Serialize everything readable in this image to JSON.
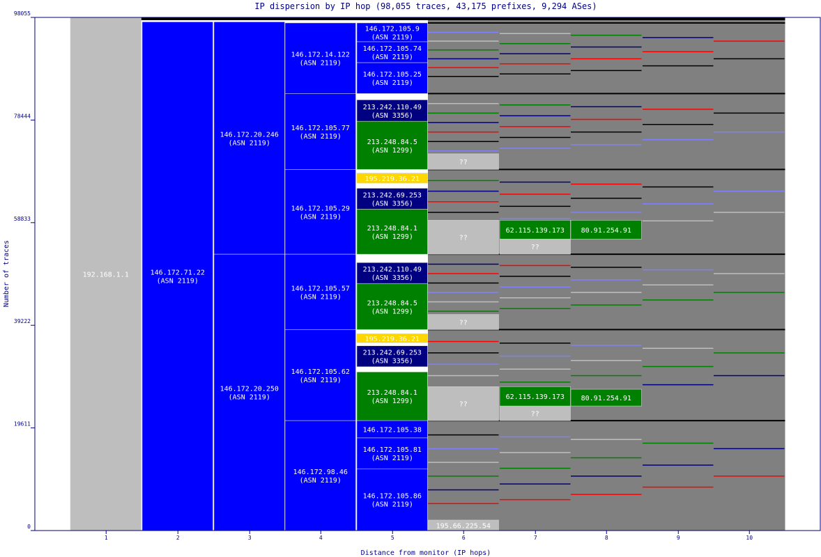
{
  "chart_data": {
    "type": "bar",
    "title": "IP dispersion by IP hop (98,055 traces, 43,175 prefixes, 9,294 ASes)",
    "xlabel": "Distance from monitor (IP hops)",
    "ylabel": "Number of traces",
    "ylim": [
      0,
      98055
    ],
    "yticks": [
      "0",
      "19611",
      "39222",
      "58833",
      "78444",
      "98055"
    ],
    "xticks": [
      "1",
      "2",
      "3",
      "4",
      "5",
      "6",
      "7",
      "8",
      "9",
      "10"
    ],
    "colors": {
      "private": "#bebebe",
      "unknown": "#bebebe",
      "asn2119": "#0000ff",
      "asn3356": "#000080",
      "asn1299": "#008000",
      "yellow": "#ffd700",
      "background": "#808080",
      "label": "#ffffff",
      "axis": "#000080"
    },
    "nodes": [
      {
        "hop": 1,
        "y0": 0,
        "y1": 98055,
        "color": "private",
        "ip": "192.168.1.1",
        "asn": ""
      },
      {
        "hop": 2,
        "y0": 0,
        "y1": 97200,
        "color": "asn2119",
        "ip": "146.172.71.22",
        "asn": "(ASN 2119)"
      },
      {
        "hop": 3,
        "y0": 52800,
        "y1": 97200,
        "color": "asn2119",
        "ip": "146.172.20.246",
        "asn": "(ASN 2119)"
      },
      {
        "hop": 3,
        "y0": 0,
        "y1": 52800,
        "color": "asn2119",
        "ip": "146.172.20.250",
        "asn": "(ASN 2119)"
      },
      {
        "hop": 4,
        "y0": 83500,
        "y1": 97000,
        "color": "asn2119",
        "ip": "146.172.14.122",
        "asn": "(ASN 2119)"
      },
      {
        "hop": 4,
        "y0": 69000,
        "y1": 83500,
        "color": "asn2119",
        "ip": "146.172.105.77",
        "asn": "(ASN 2119)"
      },
      {
        "hop": 4,
        "y0": 52800,
        "y1": 69000,
        "color": "asn2119",
        "ip": "146.172.105.29",
        "asn": "(ASN 2119)"
      },
      {
        "hop": 4,
        "y0": 38400,
        "y1": 52800,
        "color": "asn2119",
        "ip": "146.172.105.57",
        "asn": "(ASN 2119)"
      },
      {
        "hop": 4,
        "y0": 21000,
        "y1": 38400,
        "color": "asn2119",
        "ip": "146.172.105.62",
        "asn": "(ASN 2119)"
      },
      {
        "hop": 4,
        "y0": 0,
        "y1": 21000,
        "color": "asn2119",
        "ip": "146.172.98.46",
        "asn": "(ASN 2119)"
      },
      {
        "hop": 5,
        "y0": 93400,
        "y1": 97000,
        "color": "asn2119",
        "ip": "146.172.105.9",
        "asn": "(ASN 2119)"
      },
      {
        "hop": 5,
        "y0": 89400,
        "y1": 93400,
        "color": "asn2119",
        "ip": "146.172.105.74",
        "asn": "(ASN 2119)"
      },
      {
        "hop": 5,
        "y0": 83500,
        "y1": 89400,
        "color": "asn2119",
        "ip": "146.172.105.25",
        "asn": "(ASN 2119)"
      },
      {
        "hop": 5,
        "y0": 78200,
        "y1": 82300,
        "color": "asn3356",
        "ip": "213.242.110.49",
        "asn": "(ASN 3356)"
      },
      {
        "hop": 5,
        "y0": 69000,
        "y1": 78200,
        "color": "asn1299",
        "ip": "213.248.84.5",
        "asn": "(ASN 1299)"
      },
      {
        "hop": 5,
        "y0": 66400,
        "y1": 68300,
        "color": "yellow",
        "ip": "195.219.36.21",
        "asn": ""
      },
      {
        "hop": 5,
        "y0": 61400,
        "y1": 65400,
        "color": "asn3356",
        "ip": "213.242.69.253",
        "asn": "(ASN 3356)"
      },
      {
        "hop": 5,
        "y0": 52800,
        "y1": 61400,
        "color": "asn1299",
        "ip": "213.248.84.1",
        "asn": "(ASN 1299)"
      },
      {
        "hop": 5,
        "y0": 47200,
        "y1": 51200,
        "color": "asn3356",
        "ip": "213.242.110.49",
        "asn": "(ASN 3356)"
      },
      {
        "hop": 5,
        "y0": 38400,
        "y1": 47200,
        "color": "asn1299",
        "ip": "213.248.84.5",
        "asn": "(ASN 1299)"
      },
      {
        "hop": 5,
        "y0": 35900,
        "y1": 37600,
        "color": "yellow",
        "ip": "195.219.36.21",
        "asn": ""
      },
      {
        "hop": 5,
        "y0": 31300,
        "y1": 35300,
        "color": "asn3356",
        "ip": "213.242.69.253",
        "asn": "(ASN 3356)"
      },
      {
        "hop": 5,
        "y0": 21000,
        "y1": 30300,
        "color": "asn1299",
        "ip": "213.248.84.1",
        "asn": "(ASN 1299)"
      },
      {
        "hop": 5,
        "y0": 17700,
        "y1": 21000,
        "color": "asn2119",
        "ip": "146.172.105.38",
        "asn": ""
      },
      {
        "hop": 5,
        "y0": 11800,
        "y1": 17700,
        "color": "asn2119",
        "ip": "146.172.105.81",
        "asn": "(ASN 2119)"
      },
      {
        "hop": 5,
        "y0": 0,
        "y1": 11800,
        "color": "asn2119",
        "ip": "146.172.105.86",
        "asn": "(ASN 2119)"
      },
      {
        "hop": 6,
        "y0": 69000,
        "y1": 72000,
        "color": "unknown",
        "ip": "??",
        "asn": ""
      },
      {
        "hop": 6,
        "y0": 52800,
        "y1": 59300,
        "color": "unknown",
        "ip": "??",
        "asn": ""
      },
      {
        "hop": 6,
        "y0": 38400,
        "y1": 41300,
        "color": "unknown",
        "ip": "??",
        "asn": ""
      },
      {
        "hop": 6,
        "y0": 21000,
        "y1": 27500,
        "color": "unknown",
        "ip": "??",
        "asn": ""
      },
      {
        "hop": 6,
        "y0": 0,
        "y1": 2000,
        "color": "unknown",
        "ip": "195.66.225.54",
        "asn": ""
      },
      {
        "hop": 7,
        "y0": 52800,
        "y1": 55700,
        "color": "unknown",
        "ip": "??",
        "asn": ""
      },
      {
        "hop": 7,
        "y0": 55700,
        "y1": 59300,
        "color": "asn1299",
        "ip": "62.115.139.173",
        "asn": ""
      },
      {
        "hop": 7,
        "y0": 21000,
        "y1": 23800,
        "color": "unknown",
        "ip": "??",
        "asn": ""
      },
      {
        "hop": 7,
        "y0": 23800,
        "y1": 27500,
        "color": "asn1299",
        "ip": "62.115.139.173",
        "asn": ""
      },
      {
        "hop": 8,
        "y0": 55700,
        "y1": 59300,
        "color": "asn1299",
        "ip": "80.91.254.91",
        "asn": ""
      },
      {
        "hop": 8,
        "y0": 23800,
        "y1": 27000,
        "color": "asn1299",
        "ip": "80.91.254.91",
        "asn": ""
      }
    ]
  }
}
